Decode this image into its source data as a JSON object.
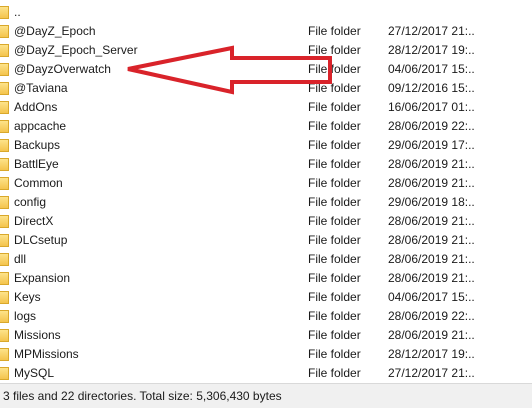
{
  "files": [
    {
      "name": "..",
      "type": "",
      "modified": ""
    },
    {
      "name": "@DayZ_Epoch",
      "type": "File folder",
      "modified": "27/12/2017 21:.."
    },
    {
      "name": "@DayZ_Epoch_Server",
      "type": "File folder",
      "modified": "28/12/2017 19:.."
    },
    {
      "name": "@DayzOverwatch",
      "type": "File folder",
      "modified": "04/06/2017 15:.."
    },
    {
      "name": "@Taviana",
      "type": "File folder",
      "modified": "09/12/2016 15:.."
    },
    {
      "name": "AddOns",
      "type": "File folder",
      "modified": "16/06/2017 01:.."
    },
    {
      "name": "appcache",
      "type": "File folder",
      "modified": "28/06/2019 22:.."
    },
    {
      "name": "Backups",
      "type": "File folder",
      "modified": "29/06/2019 17:.."
    },
    {
      "name": "BattlEye",
      "type": "File folder",
      "modified": "28/06/2019 21:.."
    },
    {
      "name": "Common",
      "type": "File folder",
      "modified": "28/06/2019 21:.."
    },
    {
      "name": "config",
      "type": "File folder",
      "modified": "29/06/2019 18:.."
    },
    {
      "name": "DirectX",
      "type": "File folder",
      "modified": "28/06/2019 21:.."
    },
    {
      "name": "DLCsetup",
      "type": "File folder",
      "modified": "28/06/2019 21:.."
    },
    {
      "name": "dll",
      "type": "File folder",
      "modified": "28/06/2019 21:.."
    },
    {
      "name": "Expansion",
      "type": "File folder",
      "modified": "28/06/2019 21:.."
    },
    {
      "name": "Keys",
      "type": "File folder",
      "modified": "04/06/2017 15:.."
    },
    {
      "name": "logs",
      "type": "File folder",
      "modified": "28/06/2019 22:.."
    },
    {
      "name": "Missions",
      "type": "File folder",
      "modified": "28/06/2019 21:.."
    },
    {
      "name": "MPMissions",
      "type": "File folder",
      "modified": "28/12/2017 19:.."
    },
    {
      "name": "MySQL",
      "type": "File folder",
      "modified": "27/12/2017 21:.."
    }
  ],
  "status": {
    "text": "3 files and 22 directories. Total size: 5,306,430 bytes"
  },
  "annotation": {
    "color": "#d9232a"
  }
}
